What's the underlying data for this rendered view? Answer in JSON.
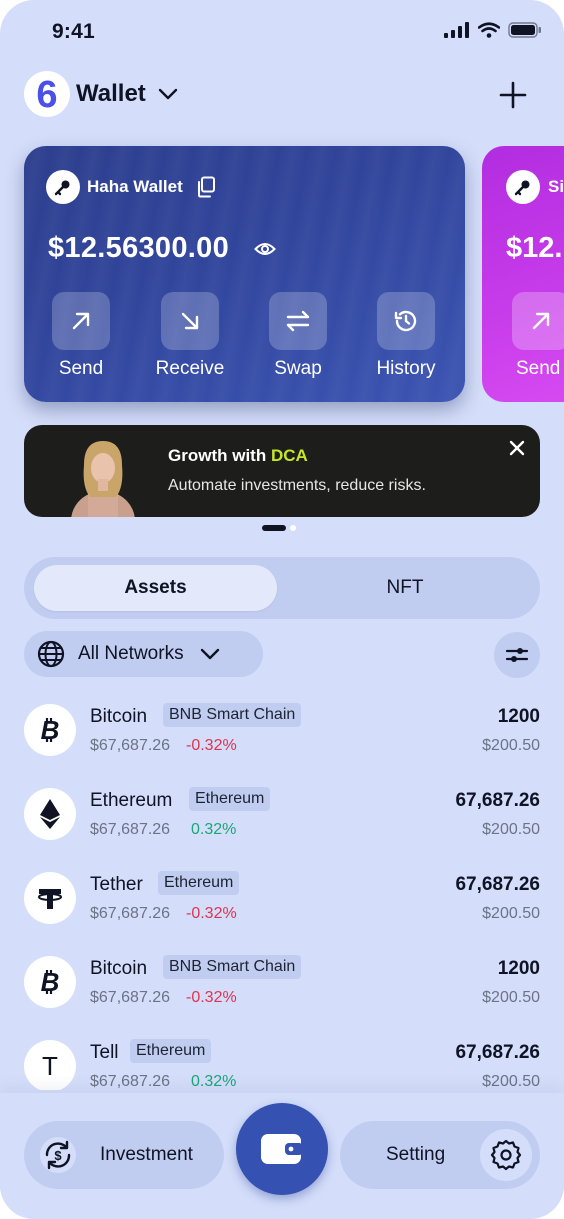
{
  "status_bar": {
    "time": "9:41"
  },
  "header": {
    "title": "Wallet",
    "logo_text": "6"
  },
  "cards": [
    {
      "name": "Haha Wallet",
      "balance": "$12.56300.00",
      "actions": [
        {
          "label": "Send",
          "icon": "arrow-up-right-icon"
        },
        {
          "label": "Receive",
          "icon": "arrow-down-right-icon"
        },
        {
          "label": "Swap",
          "icon": "swap-icon"
        },
        {
          "label": "History",
          "icon": "history-icon"
        }
      ]
    },
    {
      "name": "Si",
      "balance": "$12.",
      "actions": [
        {
          "label": "Send",
          "icon": "arrow-up-right-icon"
        }
      ]
    }
  ],
  "banner": {
    "title_prefix": "Growth with ",
    "title_highlight": "DCA",
    "subtitle": "Automate investments, reduce risks.",
    "highlight_color": "#c6e62a"
  },
  "tabs": [
    {
      "label": "Assets",
      "active": true
    },
    {
      "label": "NFT",
      "active": false
    }
  ],
  "network_filter": {
    "label": "All Networks"
  },
  "assets": [
    {
      "name": "Bitcoin",
      "chain": "BNB Smart Chain",
      "price": "$67,687.26",
      "change": "-0.32%",
      "direction": "neg",
      "amount": "1200",
      "value": "$200.50",
      "icon": "bitcoin-icon"
    },
    {
      "name": "Ethereum",
      "chain": "Ethereum",
      "price": "$67,687.26",
      "change": "0.32%",
      "direction": "pos",
      "amount": "67,687.26",
      "value": "$200.50",
      "icon": "ethereum-icon"
    },
    {
      "name": "Tether",
      "chain": "Ethereum",
      "price": "$67,687.26",
      "change": "-0.32%",
      "direction": "neg",
      "amount": "67,687.26",
      "value": "$200.50",
      "icon": "tether-icon"
    },
    {
      "name": "Bitcoin",
      "chain": "BNB Smart Chain",
      "price": "$67,687.26",
      "change": "-0.32%",
      "direction": "neg",
      "amount": "1200",
      "value": "$200.50",
      "icon": "bitcoin-icon"
    },
    {
      "name": "Tell",
      "chain": "Ethereum",
      "price": "$67,687.26",
      "change": "0.32%",
      "direction": "pos",
      "amount": "67,687.26",
      "value": "$200.50",
      "icon": "tell-icon",
      "icon_text": "T"
    }
  ],
  "bottom_nav": {
    "left_label": "Investment",
    "right_label": "Setting"
  },
  "colors": {
    "background": "#d4defa",
    "card": "#30449a",
    "accent": "#3551b2",
    "negative": "#e0334f",
    "positive": "#19a774"
  }
}
